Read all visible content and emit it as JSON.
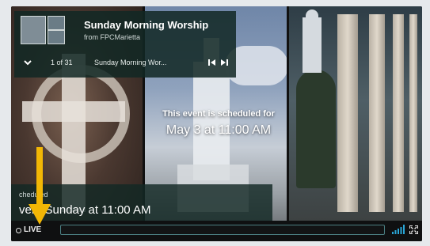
{
  "event": {
    "title": "Sunday Morning Worship",
    "organizer": "from FPCMarietta",
    "counter": "1 of 31",
    "playlist_title": "Sunday Morning Wor..."
  },
  "overlay": {
    "message": "This event is scheduled for",
    "date": "May 3 at 11:00 AM"
  },
  "schedule": {
    "label": "cheduled",
    "time": "very Sunday at 11:00 AM"
  },
  "controls": {
    "live_label": "LIVE"
  },
  "colors": {
    "card_bg": "#12282480",
    "accent": "#2aa7d8",
    "annotation_arrow": "#f2b705"
  }
}
